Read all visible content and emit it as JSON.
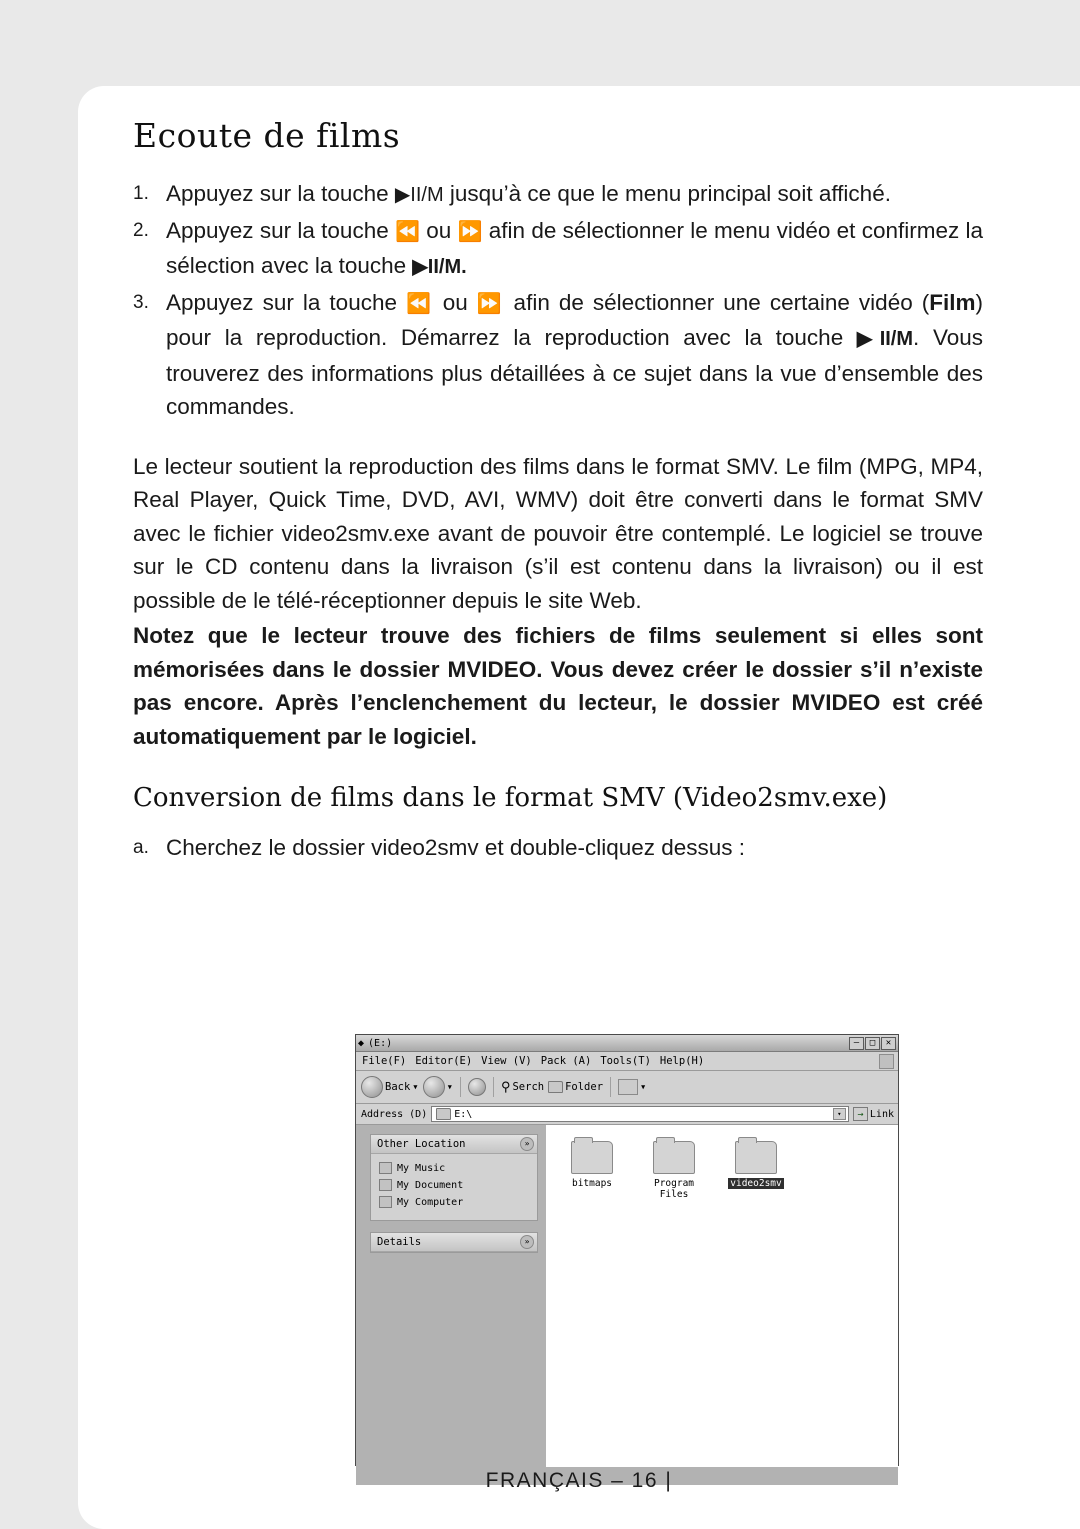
{
  "document": {
    "title": "Ecoute de films",
    "steps": [
      {
        "num": "1.",
        "parts": [
          {
            "t": "text",
            "v": "Appuyez sur la touche "
          },
          {
            "t": "glyph",
            "v": "▶II/M"
          },
          {
            "t": "text",
            "v": " jusqu’à ce que le menu principal soit affiché."
          }
        ]
      },
      {
        "num": "2.",
        "parts": [
          {
            "t": "text",
            "v": "Appuyez sur la touche "
          },
          {
            "t": "glyph",
            "v": "⏪"
          },
          {
            "t": "text",
            "v": " ou "
          },
          {
            "t": "glyph",
            "v": "⏩"
          },
          {
            "t": "text",
            "v": " afin de sélectionner le menu vidéo et confirmez la sélection avec la touche "
          },
          {
            "t": "glyph-bold",
            "v": "▶II/M."
          }
        ]
      },
      {
        "num": "3.",
        "parts": [
          {
            "t": "text",
            "v": "Appuyez sur la touche "
          },
          {
            "t": "glyph",
            "v": "⏪"
          },
          {
            "t": "text",
            "v": " ou "
          },
          {
            "t": "glyph",
            "v": "⏩"
          },
          {
            "t": "text",
            "v": " afin de sélectionner une certaine vidéo ("
          },
          {
            "t": "bold",
            "v": "Film"
          },
          {
            "t": "text",
            "v": ") pour la reproduction. Démarrez la reproduction avec la touche "
          },
          {
            "t": "glyph-bold",
            "v": "▶II/M"
          },
          {
            "t": "text",
            "v": ". Vous trouverez des informations plus détaillées à ce sujet dans la vue d’ensemble des commandes."
          }
        ]
      }
    ],
    "paragraph": "Le lecteur soutient la reproduction des films dans le format SMV. Le film (MPG, MP4, Real Player, Quick Time, DVD, AVI, WMV) doit être converti dans le format SMV avec le fichier video2smv.exe avant de pouvoir être contemplé. Le logiciel se trouve sur le CD contenu dans la livraison (s’il est contenu dans la livraison) ou il est possible de le télé-réceptionner depuis le site Web.",
    "note": "Notez que le lecteur trouve des fichiers de films seulement si elles sont mémorisées dans le dossier MVIDEO. Vous devez créer le dossier s’il n’existe pas encore. Après l’enclenchement du lecteur, le dossier MVIDEO est créé automatiquement par le logiciel.",
    "subtitle": "Conversion de films dans le format SMV (Video2smv.exe)",
    "lettered_item": {
      "num": "a.",
      "text": "Cherchez le dossier video2smv et double-cliquez dessus :"
    },
    "footer": "FRANÇAIS – 16  |"
  },
  "explorer": {
    "title": "(E:)",
    "window_buttons": {
      "minimize": "–",
      "maximize": "□",
      "close": "✕"
    },
    "menu": [
      "File(F)",
      "Editor(E)",
      "View (V)",
      "Pack (A)",
      "Tools(T)",
      "Help(H)"
    ],
    "toolbar": {
      "back": "Back",
      "back_caret": "▾",
      "forward_caret": "▾",
      "search": "Serch",
      "folder": "Folder",
      "views_caret": "▾"
    },
    "address": {
      "label": "Address (D)",
      "value": "E:\\",
      "dropdown_caret": "▾",
      "go_label": "Link",
      "go_arrow": "→"
    },
    "sidebar": {
      "panel1": {
        "title": "Other Location",
        "collapse": "»",
        "items": [
          "My Music",
          "My Document",
          "My Computer"
        ]
      },
      "panel2": {
        "title": "Details",
        "collapse": "»"
      }
    },
    "files": [
      {
        "name": "bitmaps",
        "selected": false
      },
      {
        "name": "Program\nFiles",
        "selected": false
      },
      {
        "name": "video2smv",
        "selected": true
      }
    ]
  }
}
